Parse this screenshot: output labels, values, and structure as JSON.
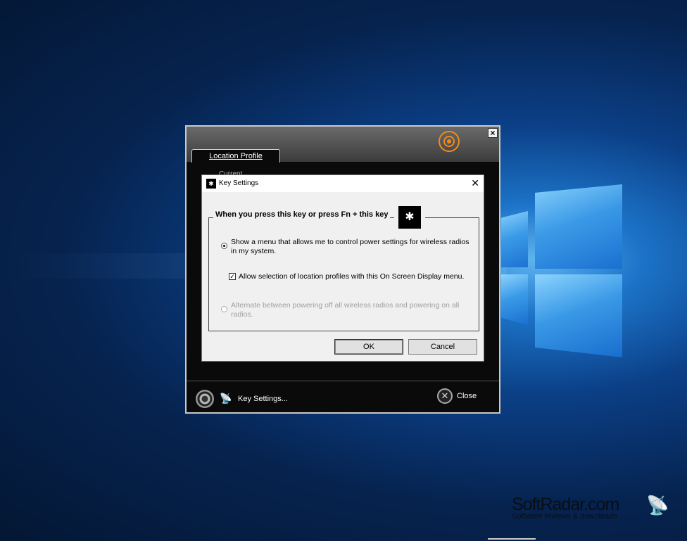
{
  "app": {
    "tab_label": "Location Profile",
    "profile_label": "Current",
    "key_settings_label": "Key Settings...",
    "close_label": "Close",
    "close_glyph": "✕",
    "window_close_glyph": "×",
    "accent_color": "#f08a1c"
  },
  "dialog": {
    "title": "Key Settings",
    "close_glyph": "✕",
    "group_heading": "When you press this key or press Fn + this key",
    "option1_text": "Show a menu that allows me to control power settings for wireless radios in my system.",
    "option1_selected": true,
    "checkbox_text": "Allow selection of location profiles with this On Screen Display menu.",
    "checkbox_checked": true,
    "option2_text": "Alternate between powering off all wireless radios and powering on all radios.",
    "option2_selected": false,
    "ok_label": "OK",
    "cancel_label": "Cancel"
  },
  "watermark": {
    "title": "SoftRadar.com",
    "subtitle": "Software reviews & downloads"
  }
}
